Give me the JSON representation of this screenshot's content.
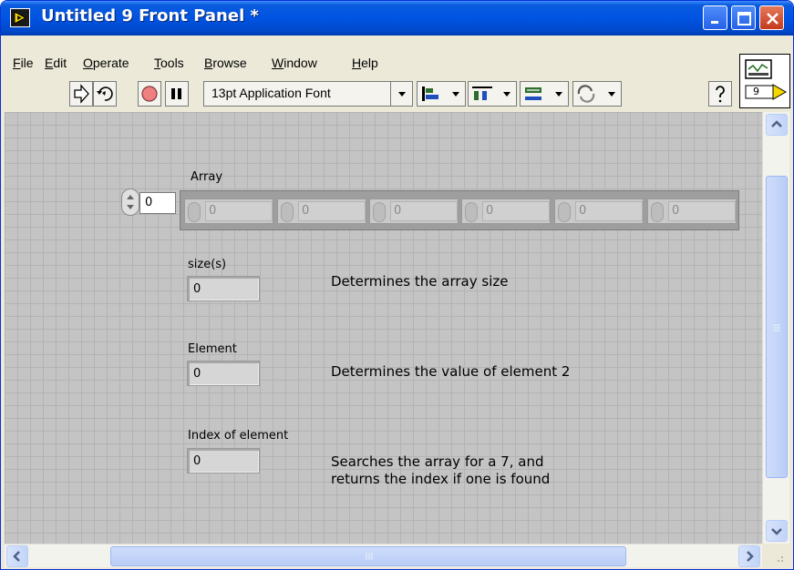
{
  "window": {
    "title": "Untitled 9 Front Panel *"
  },
  "menu": {
    "items": [
      "File",
      "Edit",
      "Operate",
      "Tools",
      "Browse",
      "Window",
      "Help"
    ]
  },
  "toolbar": {
    "font_label": "13pt Application Font",
    "buttons": [
      "run-icon",
      "run-continuously-icon",
      "abort-icon",
      "pause-icon",
      "align-objects-icon",
      "distribute-objects-icon",
      "resize-objects-icon",
      "reorder-icon",
      "help-icon"
    ],
    "vi_icon_number": "9"
  },
  "panel": {
    "array": {
      "label": "Array",
      "index_value": "0",
      "elements": [
        "0",
        "0",
        "0",
        "0",
        "0",
        "0"
      ]
    },
    "size": {
      "label": "size(s)",
      "value": "0",
      "description": "Determines the array size"
    },
    "element": {
      "label": "Element",
      "value": "0",
      "description": "Determines the value of element 2"
    },
    "index_of_element": {
      "label": "Index of element",
      "value": "0",
      "description_line1": "Searches the array for a 7, and",
      "description_line2": "returns the index if one is found"
    }
  },
  "colors": {
    "titlebar": "#0054e3",
    "canvas_bg": "#c4c4c4",
    "grid": "#b3b3b3"
  }
}
